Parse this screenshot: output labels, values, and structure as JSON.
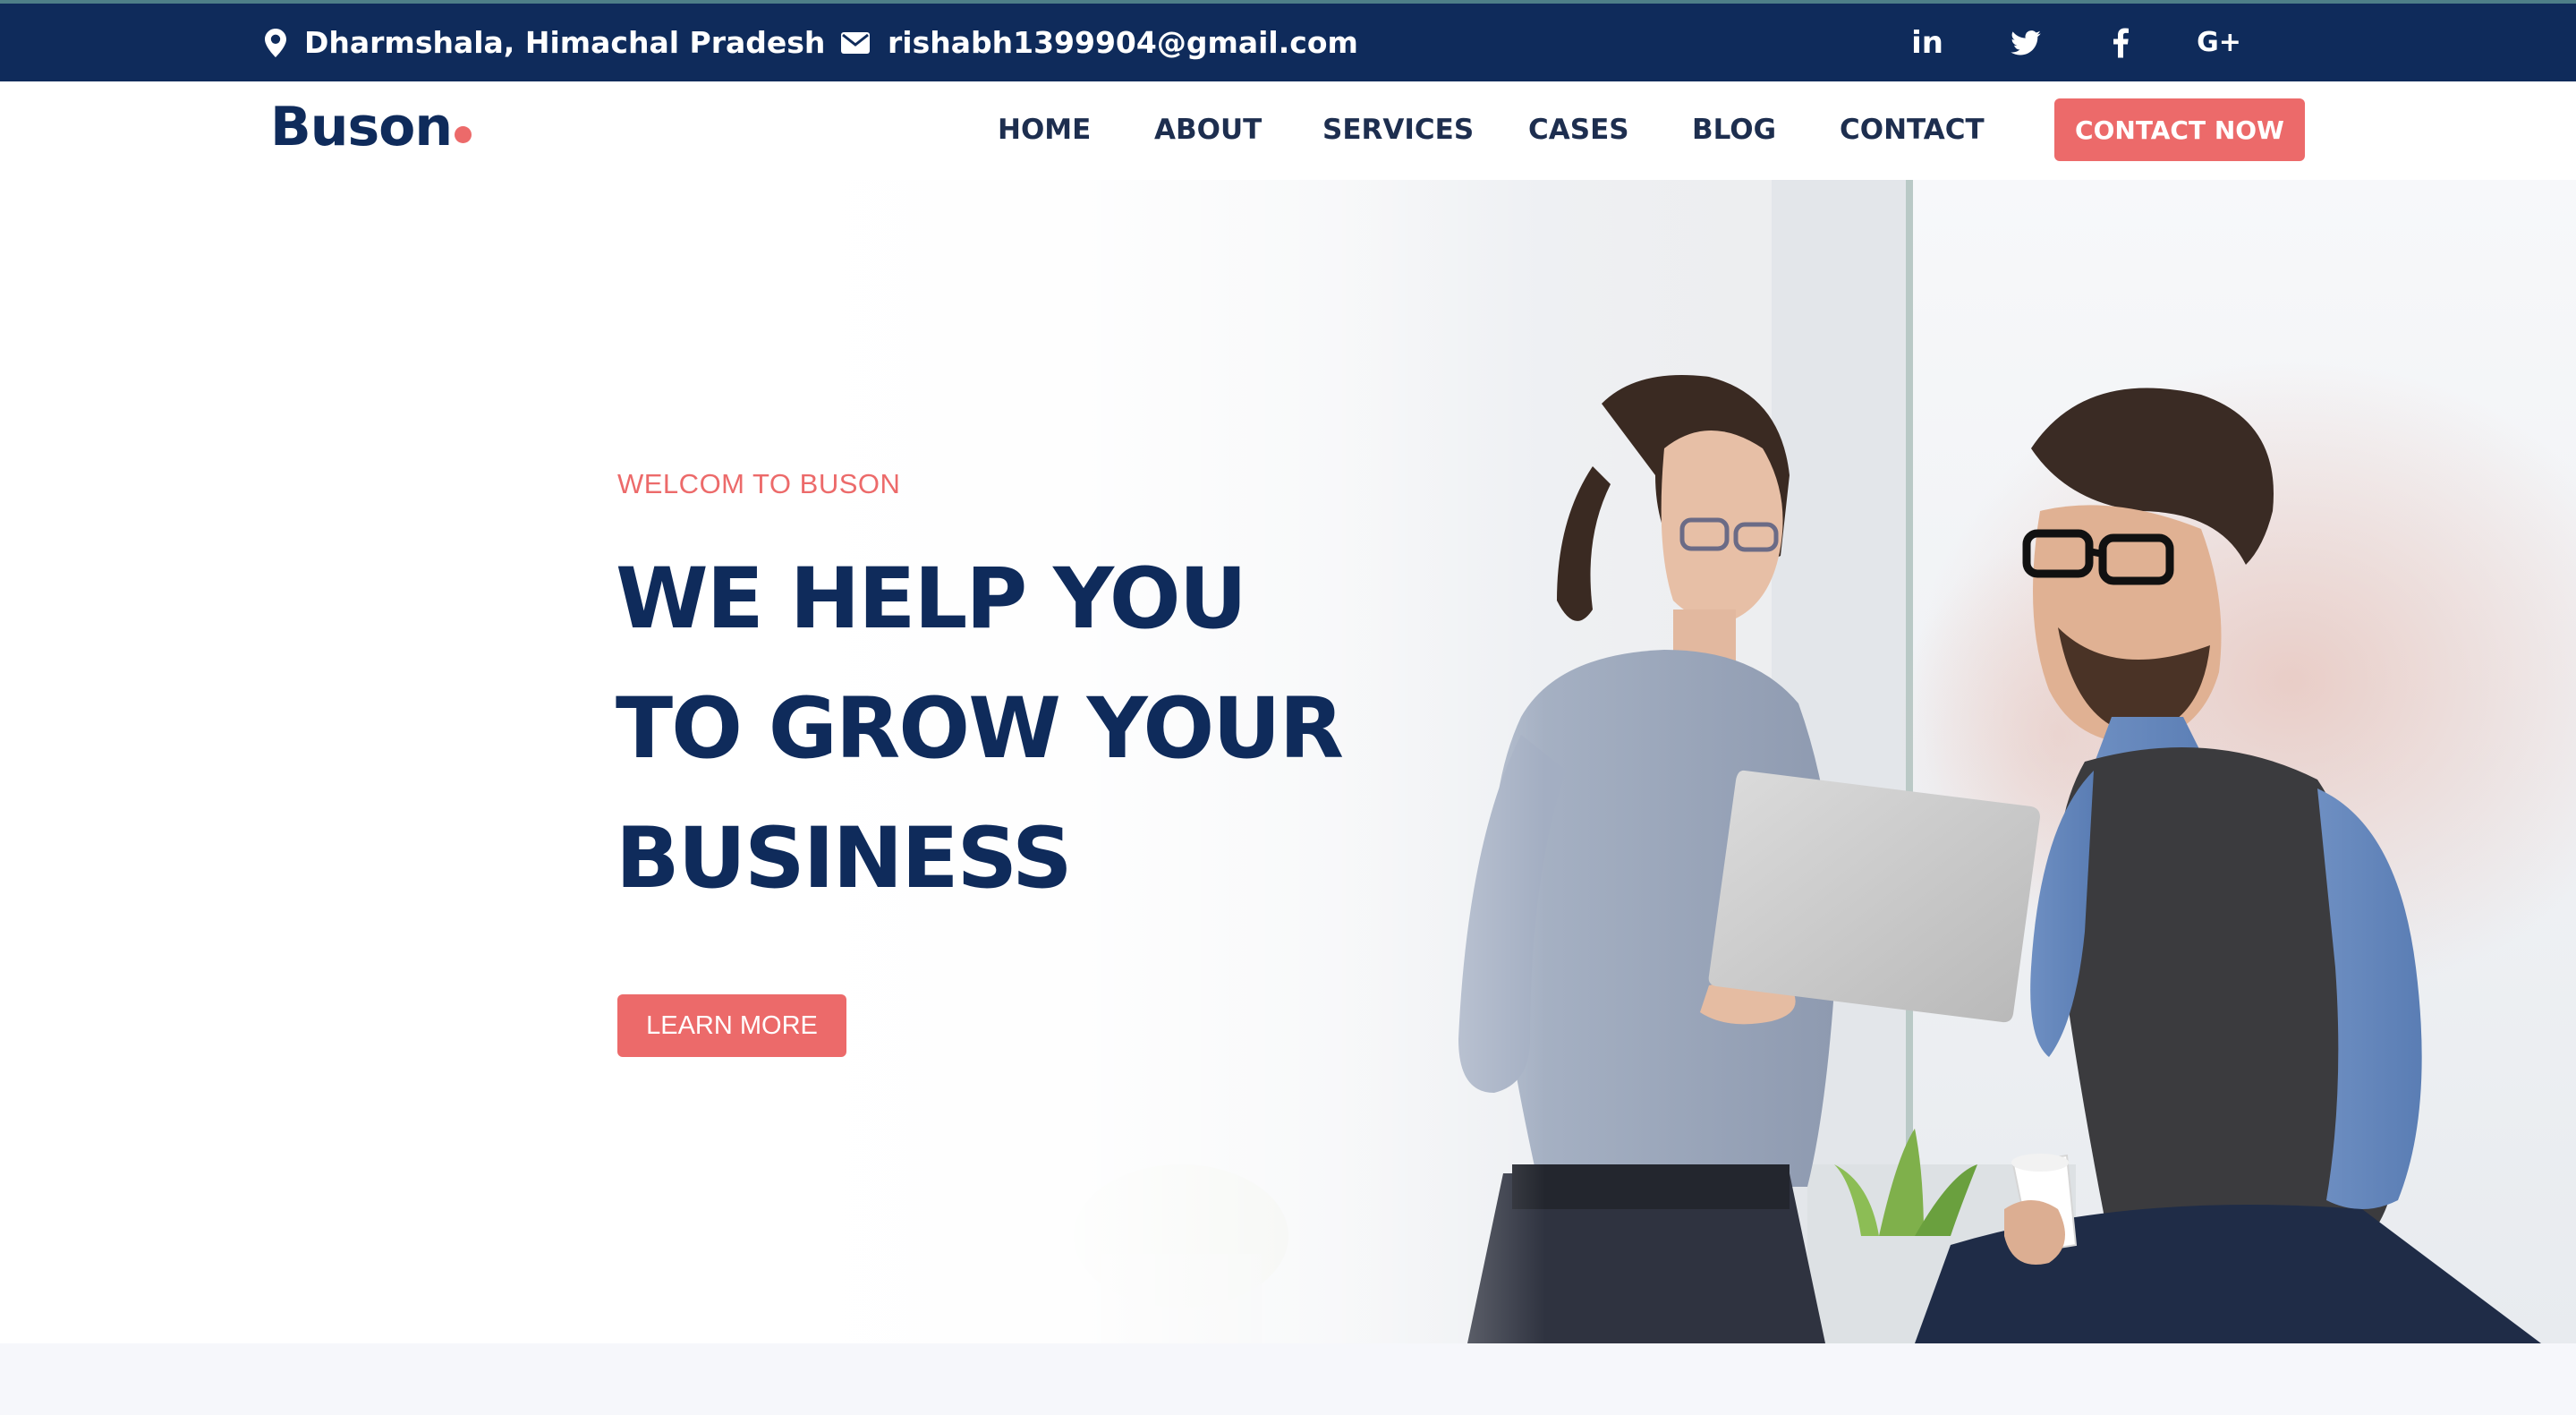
{
  "topbar": {
    "location": "Dharmshala, Himachal Pradesh",
    "email": "rishabh1399904@gmail.com",
    "location_icon": "map-pin-icon",
    "email_icon": "envelope-icon",
    "social": [
      {
        "name": "linkedin-icon",
        "glyph": "in"
      },
      {
        "name": "twitter-icon"
      },
      {
        "name": "facebook-icon"
      },
      {
        "name": "google-plus-icon",
        "glyph": "G+"
      }
    ]
  },
  "nav": {
    "logo": "Buson",
    "links": [
      "HOME",
      "ABOUT",
      "SERVICES",
      "CASES",
      "BLOG",
      "CONTACT"
    ],
    "cta": "CONTACT NOW"
  },
  "hero": {
    "welcome": "WELCOM TO BUSON",
    "headline": [
      "WE HELP YOU",
      "TO GROW YOUR",
      "BUSINESS"
    ],
    "button": "LEARN MORE"
  },
  "colors": {
    "navy": "#0f2b5b",
    "accent": "#ec6a6a",
    "white": "#ffffff"
  }
}
